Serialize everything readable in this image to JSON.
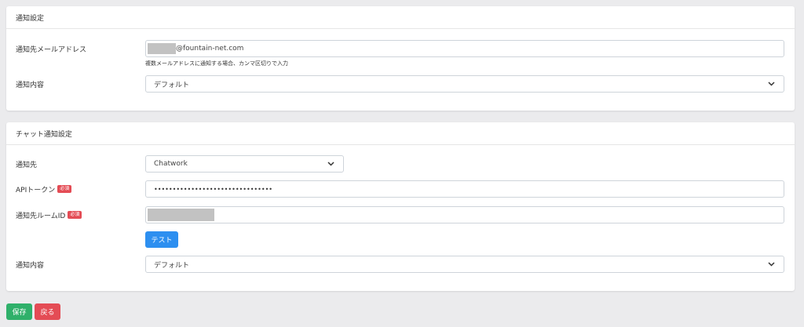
{
  "email_section": {
    "title": "通知設定",
    "email_label": "通知先メールアドレス",
    "email_value": "@fountain-net.com",
    "email_help": "複数メールアドレスに通知する場合、カンマ区切りで入力",
    "content_label": "通知内容",
    "content_value": "デフォルト"
  },
  "chat_section": {
    "title": "チャット通知設定",
    "dest_label": "通知先",
    "dest_value": "Chatwork",
    "token_label": "APIトークン",
    "token_value": "••••••••••••••••••••••••••••••••",
    "room_label": "通知先ルームID",
    "required_badge": "必須",
    "test_button": "テスト",
    "content_label": "通知内容",
    "content_value": "デフォルト"
  },
  "footer": {
    "save_button": "保存",
    "back_button": "戻る"
  },
  "colors": {
    "save": "#2fb06a",
    "back": "#e44c55",
    "test": "#2d8ff0",
    "badge": "#e44c55"
  },
  "icons": {
    "select_arrow": "chevron-down-icon"
  }
}
